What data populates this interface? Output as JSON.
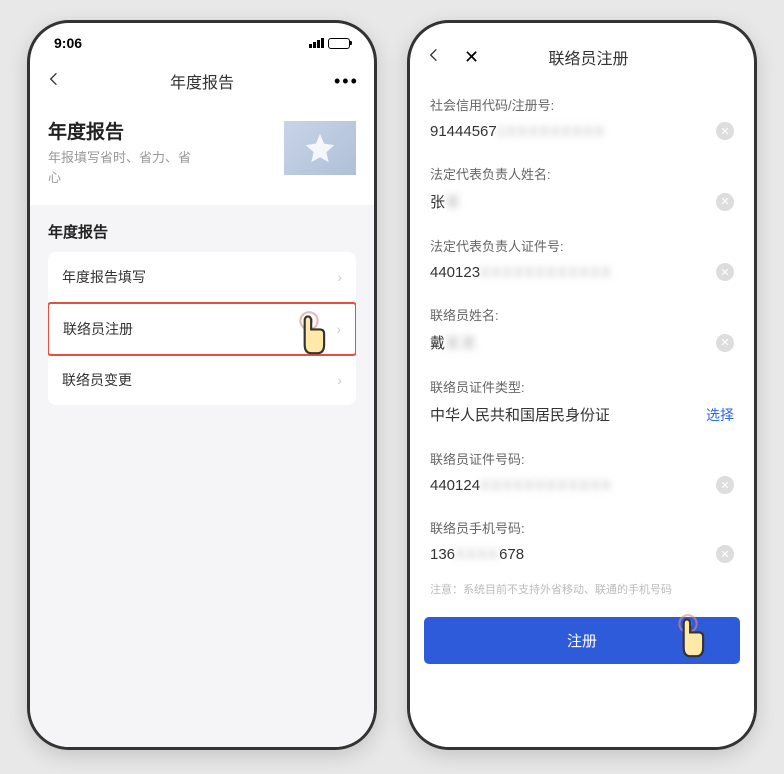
{
  "left": {
    "status_time": "9:06",
    "nav_title": "年度报告",
    "hero_title": "年度报告",
    "hero_sub": "年报填写省时、省力、省心",
    "section_title": "年度报告",
    "rows": {
      "fill": "年度报告填写",
      "register": "联络员注册",
      "change": "联络员变更"
    }
  },
  "right": {
    "nav_title": "联络员注册",
    "fields": {
      "credit_code": {
        "label": "社会信用代码/注册号:",
        "prefix": "91444567",
        "masked": "1XXXXXXXXX"
      },
      "legal_name": {
        "label": "法定代表负责人姓名:",
        "prefix": "张",
        "masked": "某"
      },
      "legal_id": {
        "label": "法定代表负责人证件号:",
        "prefix": "440123",
        "masked": "XXXXXXXXXXXX"
      },
      "contact_name": {
        "label": "联络员姓名:",
        "prefix": "戴",
        "masked": "某某"
      },
      "id_type": {
        "label": "联络员证件类型:",
        "value": "中华人民共和国居民身份证",
        "select": "选择"
      },
      "contact_id": {
        "label": "联络员证件号码:",
        "prefix": "440124",
        "masked": "XXXXXXXXXXXX"
      },
      "contact_phone": {
        "label": "联络员手机号码:",
        "prefix": "136",
        "masked": "XXXX",
        "suffix": "678"
      }
    },
    "note": "注意：系统目前不支持外省移动、联通的手机号码",
    "submit": "注册"
  }
}
